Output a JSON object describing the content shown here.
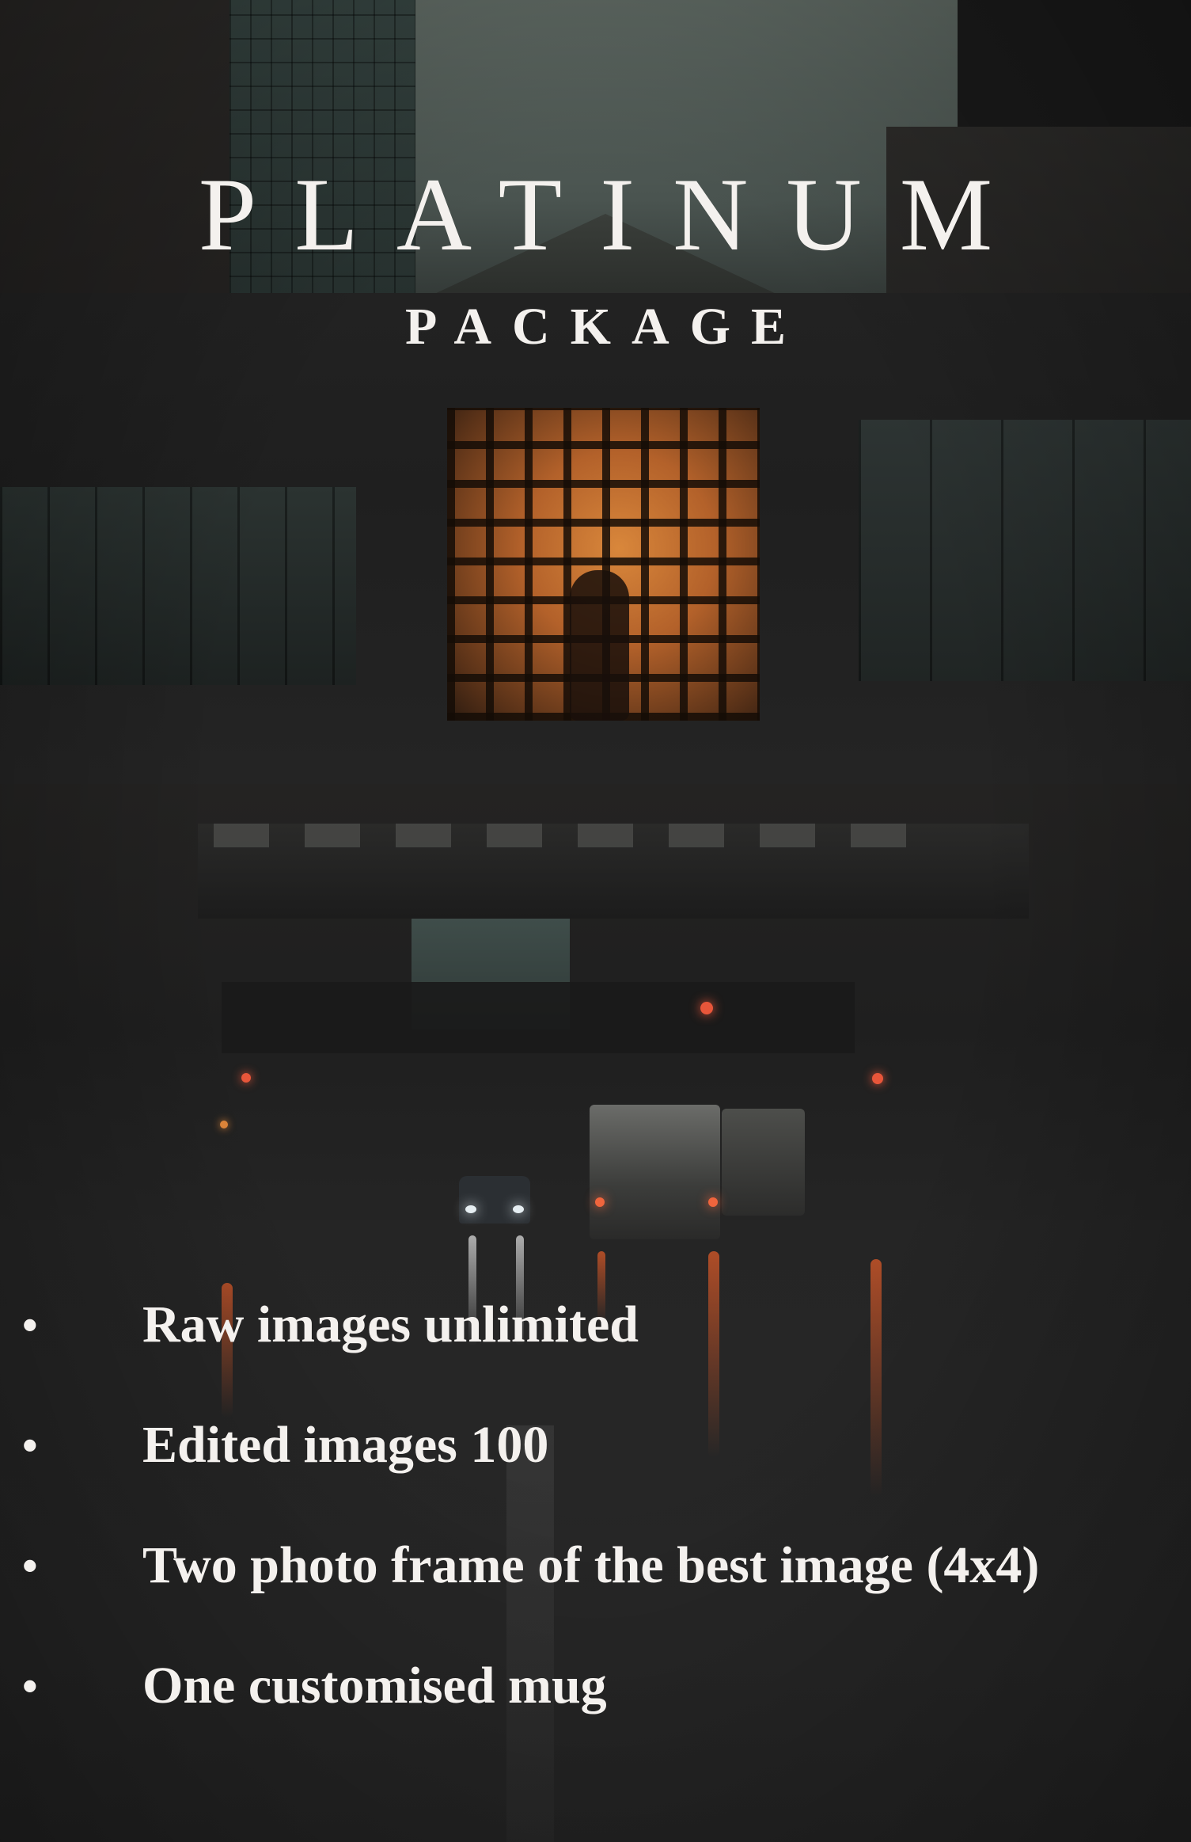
{
  "poster": {
    "title": "PLATINUM",
    "subtitle": "PACKAGE",
    "bullet_glyph": "•",
    "features": [
      "Raw images unlimited",
      "Edited images 100",
      "Two photo frame of the best image (4x4)",
      "One customised mug"
    ],
    "text_color": "#f4f1ee",
    "accent_glow_color": "#d9873b"
  }
}
